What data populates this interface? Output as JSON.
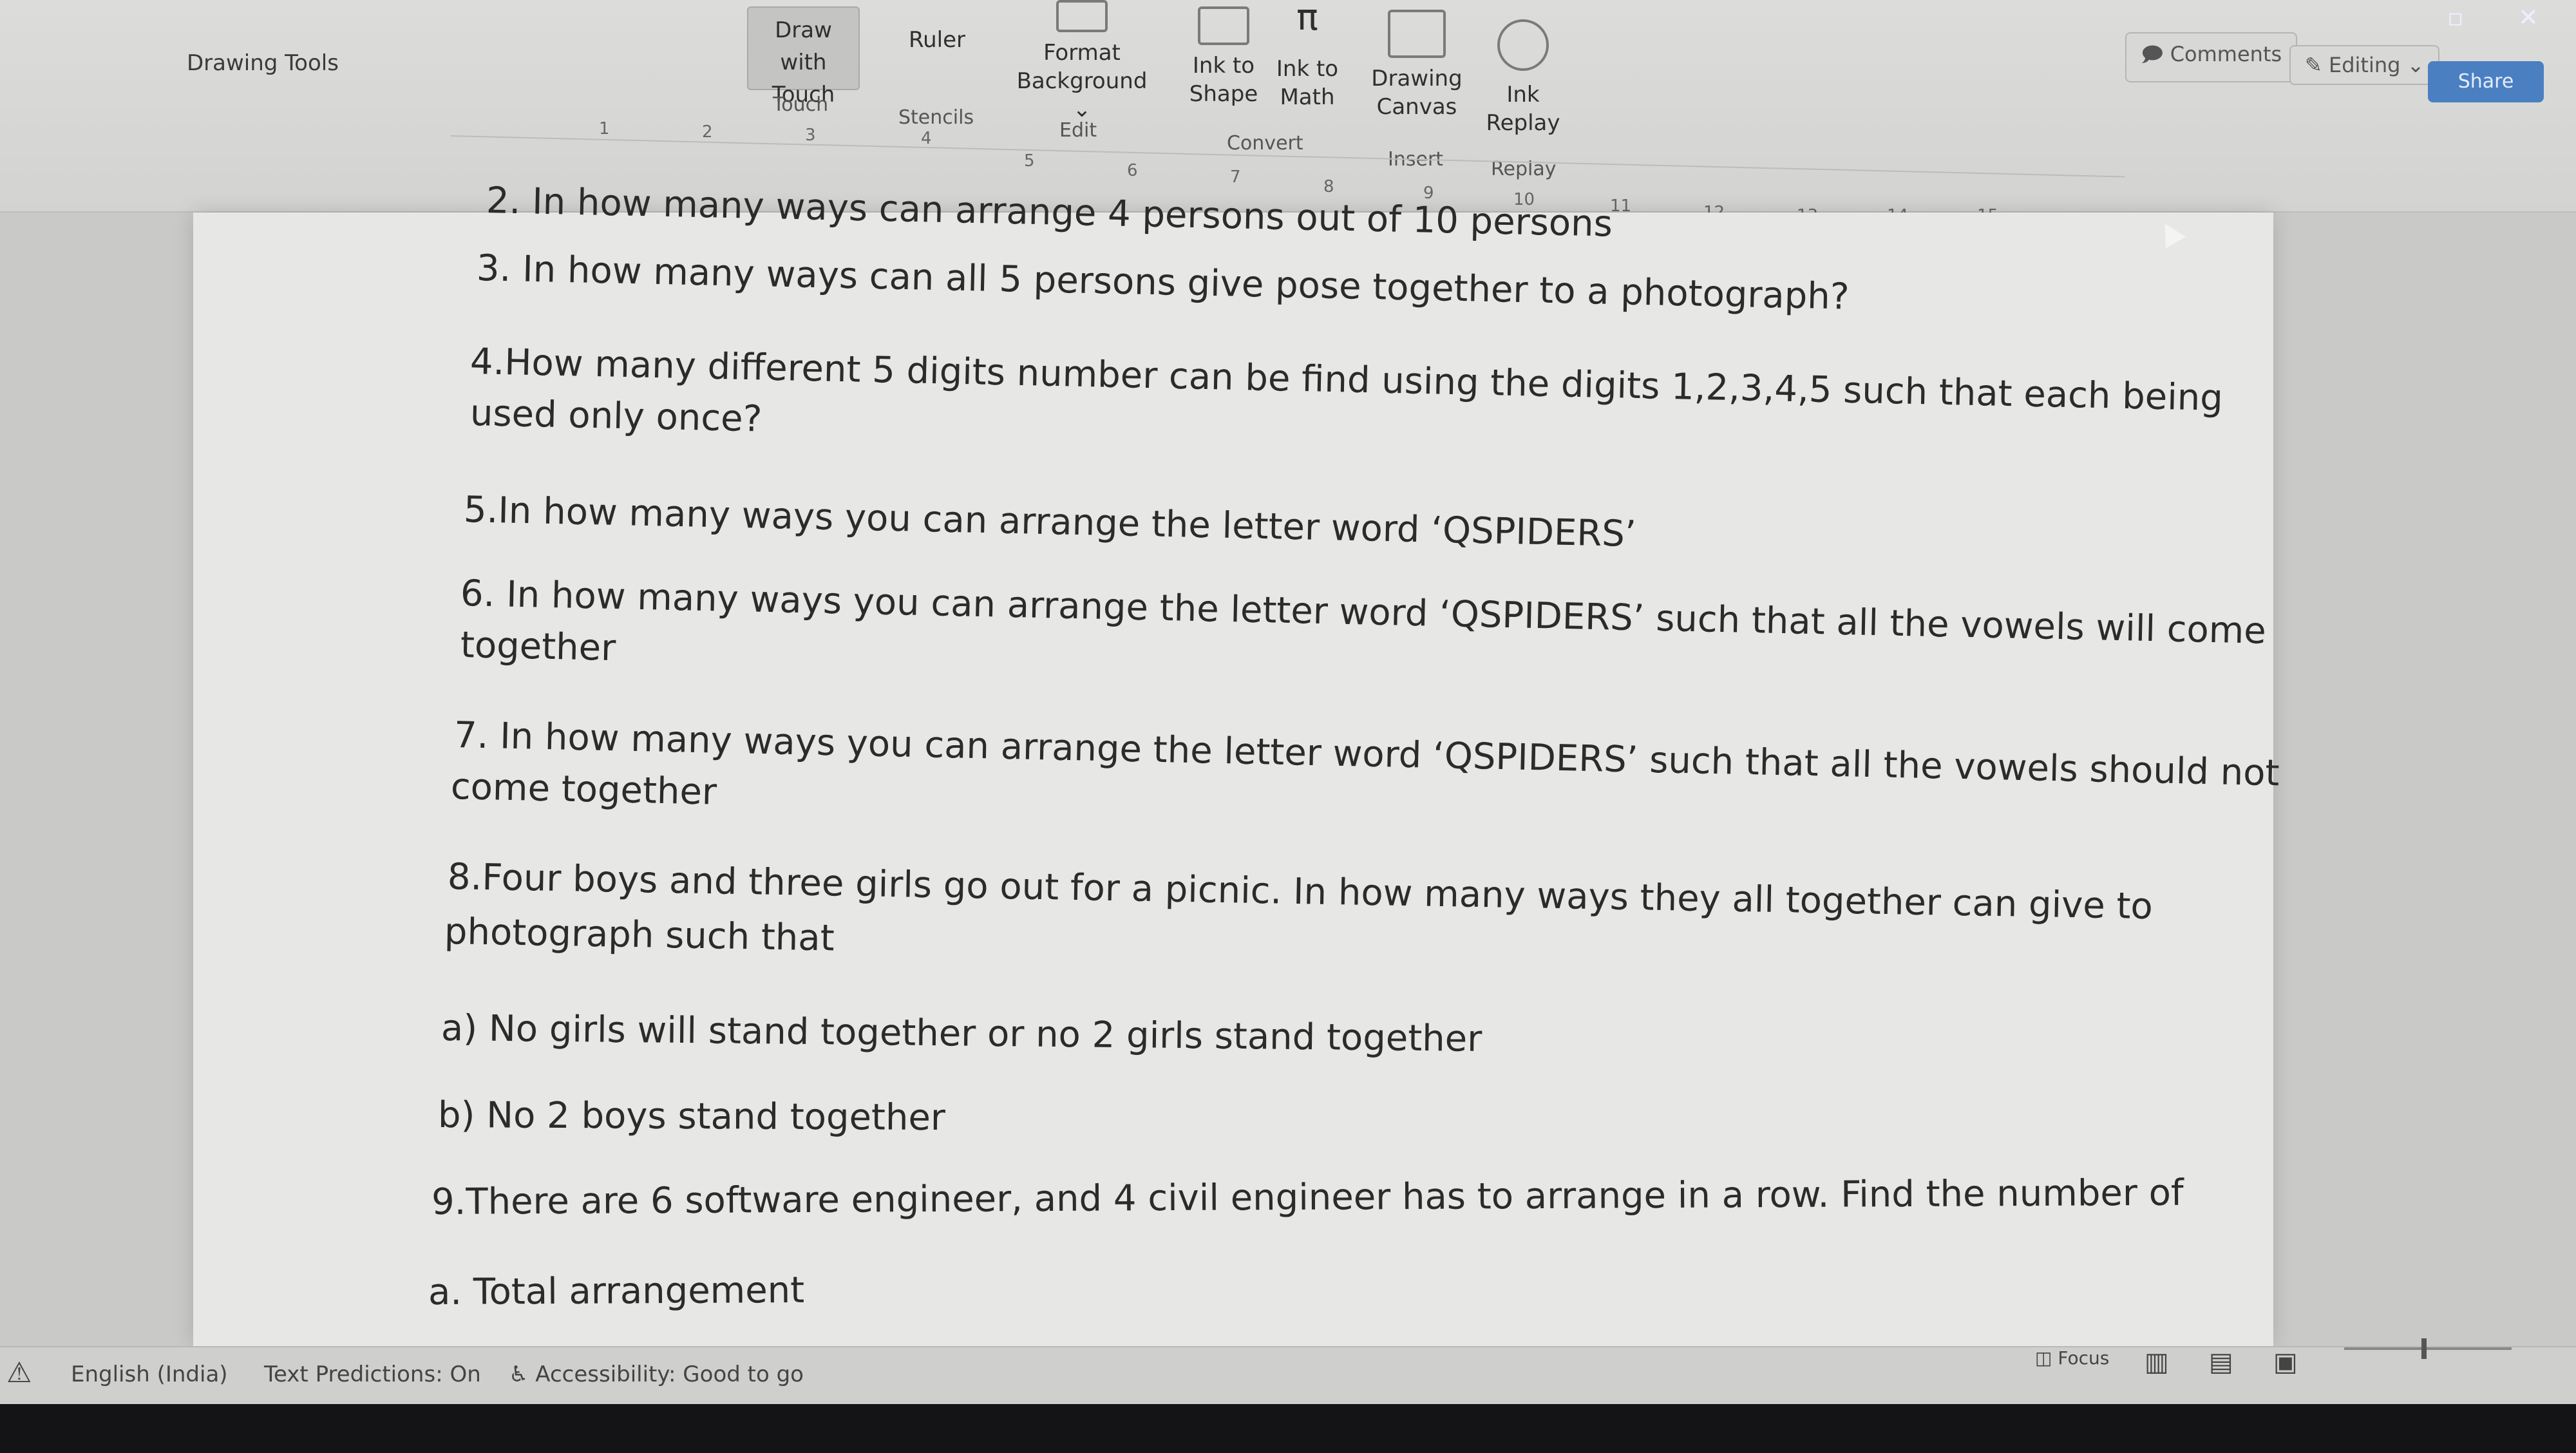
{
  "ribbon": {
    "section_title": "Drawing Tools",
    "buttons": {
      "draw_with_touch": "Draw with\nTouch",
      "ruler": "Ruler",
      "format_background": "Format\nBackground ⌄",
      "ink_to_shape": "Ink to\nShape",
      "ink_to_math": "Ink to\nMath",
      "drawing_canvas": "Drawing\nCanvas",
      "ink_replay": "Ink\nReplay"
    },
    "groups": {
      "touch": "Touch",
      "stencils": "Stencils",
      "edit": "Edit",
      "convert": "Convert",
      "insert": "Insert",
      "replay": "Replay"
    },
    "math_glyph": "π"
  },
  "title_controls": {
    "comments": "Comments",
    "editing": "Editing ⌄",
    "share": "Share"
  },
  "ruler": {
    "ticks": [
      "1",
      "2",
      "3",
      "4",
      "5",
      "6",
      "7",
      "8",
      "9",
      "10",
      "11",
      "12",
      "13",
      "14",
      "15"
    ]
  },
  "document": {
    "paragraphs": [
      "2. In how many ways can arrange 4 persons out of 10 persons",
      "3. In how many ways can all 5 persons give pose together to a photograph?",
      "4.How many different 5 digits number can be find using the digits 1,2,3,4,5 such that each being",
      "used only once?",
      "5.In how many ways you can arrange the letter word ‘QSPIDERS’",
      "6. In how many ways you can arrange the letter word ‘QSPIDERS’ such that all the vowels will come",
      "together",
      "7. In how many ways you can arrange the letter word ‘QSPIDERS’ such that all the vowels should not",
      "come together",
      "8.Four boys and three girls go out for a picnic. In how many ways they all together can give to",
      "photograph such that",
      "a) No girls will stand together or no 2 girls stand together",
      "b) No 2 boys stand together",
      "9.There are 6 software engineer, and 4 civil engineer has to arrange in a row. Find the number of",
      "a. Total arrangement"
    ]
  },
  "statusbar": {
    "language": "English (India)",
    "text_predictions": "Text Predictions: On",
    "accessibility": "Accessibility: Good to go",
    "focus": "Focus"
  }
}
